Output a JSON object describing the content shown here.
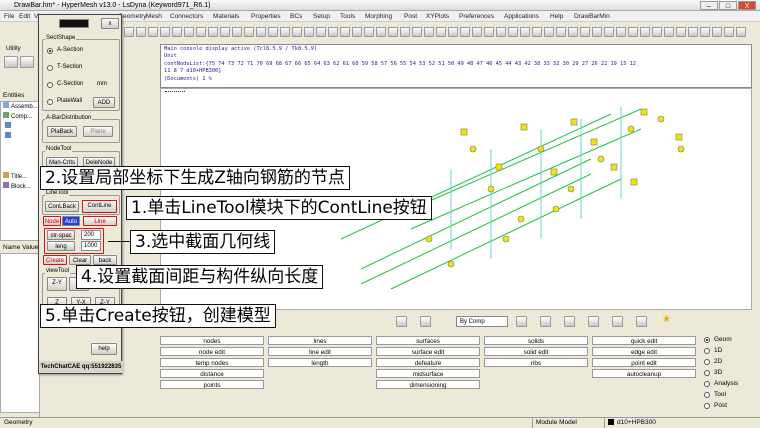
{
  "window": {
    "title": "DrawBar.hm* - HyperMesh v13.0 - LsDyna (Keyword971_R6.1)",
    "min": "–",
    "max": "□",
    "close": "X"
  },
  "menu": [
    "File",
    "Edit",
    "View",
    "Geometry",
    "Mesh",
    "Connectors",
    "Materials",
    "Properties",
    "BCs",
    "Setup",
    "Tools",
    "Morphing",
    "Post",
    "XYPlots",
    "Preferences",
    "Applications",
    "Help",
    "DrawBarMin"
  ],
  "left_panel": {
    "tabs": [
      "Utility",
      "Mask"
    ],
    "entities_label": "Entities",
    "tree": [
      "Assemb...",
      "Comp...",
      "Title...",
      "Block..."
    ],
    "name_value": "Name Value"
  },
  "dialog": {
    "title_field": "",
    "close": "x",
    "sectshape": {
      "label": "SectShape",
      "options": [
        "A-Section",
        "T-Section",
        "C-Section",
        "PlateWall"
      ],
      "selected": "A-Section",
      "unit": "mm",
      "add": "ADD"
    },
    "abar": {
      "label": "A-BarDistribution",
      "plaback": "PlaBack",
      "plane": "Plane"
    },
    "nodetool": {
      "label": "NodeTool",
      "man_crlts": "Man-Crlts",
      "delenode": "DeleNode"
    },
    "linetool": {
      "label": "LineTool",
      "conlback": "ConLBack",
      "contline": "ContLine"
    },
    "mode": {
      "node": "Node",
      "auto": "Auto",
      "line": "Line"
    },
    "params": {
      "str_spac_label": "str-spac",
      "str_spac_value": "200",
      "leng_label": "leng",
      "leng_value": "1000"
    },
    "actions": {
      "create": "Create",
      "clear": "Clear",
      "back": "back"
    },
    "viewtool": {
      "label": "viewTool",
      "zy": "Z-Y",
      "zx": "Z-X",
      "z_y": "Z-Y",
      "yx": "Y-X",
      "z": "Z",
      "y": "Y"
    },
    "back2": "back",
    "help": "help",
    "footer": "TechChatCAE qq:551922835"
  },
  "console": {
    "lines": [
      "Main console display active (Tcl8.5.9 / Tk8.5.9)",
      "Unit",
      "contNodeList:{75 74 73 72 71 70 69 68 67 66 65 64 63 62 61 60 59 58 57 56 55 54 53 52 51 50 49 48 47 46 45 44 43 42 38 33 32 30 29 27 26 22 19 15 12",
      "11 8 7 d10+HPB300}",
      "(Documents) 1 %"
    ]
  },
  "viewport_toolbar": {
    "by_comp": "By Comp"
  },
  "panel": {
    "col1": [
      "nodes",
      "node edit",
      "temp nodes",
      "distance",
      "points"
    ],
    "col2": [
      "lines",
      "line edit",
      "length"
    ],
    "col3": [
      "surfaces",
      "surface edit",
      "defeature",
      "midsurface",
      "dimensioning"
    ],
    "col4": [
      "solids",
      "solid edit",
      "ribs"
    ],
    "col5": [
      "quick edit",
      "edge edit",
      "point edit",
      "autocleanup"
    ]
  },
  "page_selector": {
    "options": [
      "Geom",
      "1D",
      "2D",
      "3D",
      "Analysis",
      "Tool",
      "Post"
    ],
    "selected": "Geom"
  },
  "statusbar": {
    "left": "Geometry",
    "module": "Module Model",
    "component": "d10+HPB300"
  },
  "annotations": {
    "step2": "2.设置局部坐标下生成Z轴向钢筋的节点",
    "step1": "1.单击LineTool模块下的ContLine按钮",
    "step3": "3.选中截面几何线",
    "step4": "4.设置截面间距与构件纵向长度",
    "step5": "5.单击Create按钮，创建模型"
  },
  "colors": {
    "highlight_red": "#e01010",
    "model_green": "#20c040",
    "node_yellow": "#f2e600",
    "console_blue": "#2222aa"
  }
}
